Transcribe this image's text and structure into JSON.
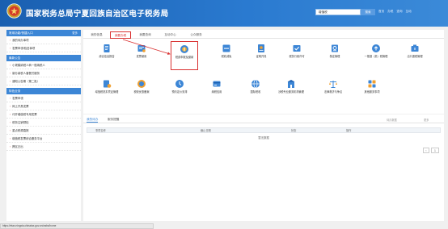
{
  "header": {
    "title": "国家税务总局宁夏回族自治区电子税务局",
    "search_value": "增值税",
    "search_button": "搜索",
    "links": [
      "首页",
      "办税",
      "查询",
      "互动"
    ]
  },
  "sidebar": {
    "sections": [
      {
        "title": "常用功能/快捷入口",
        "more": "更多",
        "items": [
          "我的待办事项",
          "发票申领/验旧事项"
        ]
      },
      {
        "title": "最新公告",
        "items": [
          "小规模纳税人转一般纳税人",
          "新办纳税人套餐式服务",
          "通知公告期（第二批）"
        ]
      },
      {
        "title": "特色业务",
        "items": [
          "发票申领",
          "网上开具发票",
          "代开增值税专用发票",
          "税务注销预检",
          "重点税源直报",
          "增值税发票综合服务平台",
          "跨区迁出"
        ]
      }
    ]
  },
  "main": {
    "tabs": [
      {
        "label": "我的信息",
        "active": false
      },
      {
        "label": "我要办税",
        "active": true
      },
      {
        "label": "我要查询",
        "active": false
      },
      {
        "label": "互动中心",
        "active": false
      },
      {
        "label": "公众服务",
        "active": false
      }
    ],
    "tiles": [
      {
        "label": "综合信息报告",
        "icon": "report-icon"
      },
      {
        "label": "发票使用",
        "icon": "invoice-icon"
      },
      {
        "label": "税费申报及缴纳",
        "icon": "tax-filing-icon",
        "highlight": true
      },
      {
        "label": "税收减免",
        "icon": "tax-reduction-icon"
      },
      {
        "label": "证明开具",
        "icon": "certificate-icon"
      },
      {
        "label": "税务行政许可",
        "icon": "license-icon"
      },
      {
        "label": "核定管理",
        "icon": "verification-icon"
      },
      {
        "label": "一般退（抵）税管理",
        "icon": "refund-icon"
      },
      {
        "label": "出口退税管理",
        "icon": "export-refund-icon"
      },
      {
        "label": "增值税抵扣凭证管理",
        "icon": "vat-deduction-icon"
      },
      {
        "label": "税收优惠备案",
        "icon": "tax-preference-icon"
      },
      {
        "label": "预约定价安排",
        "icon": "pricing-icon"
      },
      {
        "label": "纳税信用",
        "icon": "credit-icon"
      },
      {
        "label": "国际税收",
        "icon": "international-icon"
      },
      {
        "label": "涉税专业服务机构管理",
        "icon": "agency-icon"
      },
      {
        "label": "法律救济与争议",
        "icon": "legal-icon"
      },
      {
        "label": "其他服务事项",
        "icon": "other-services-icon"
      }
    ]
  },
  "lower": {
    "tabs": [
      {
        "label": "我的待办",
        "active": true
      },
      {
        "label": "服务提醒",
        "active": false
      }
    ],
    "meta": [
      "待办数据",
      "更多"
    ],
    "columns": [
      "事项名称",
      "截止日期",
      "状态",
      "操作"
    ],
    "empty_text": "暂无数据",
    "pager": {
      "prev": "‹",
      "page": "1"
    }
  },
  "statusbar": {
    "url": "https://etax.ningxia.chinatax.gov.cn/wsbs/home"
  },
  "colors": {
    "brand_blue": "#1a5fb0",
    "section_blue": "#3c86d6",
    "highlight_red": "#d93030"
  }
}
